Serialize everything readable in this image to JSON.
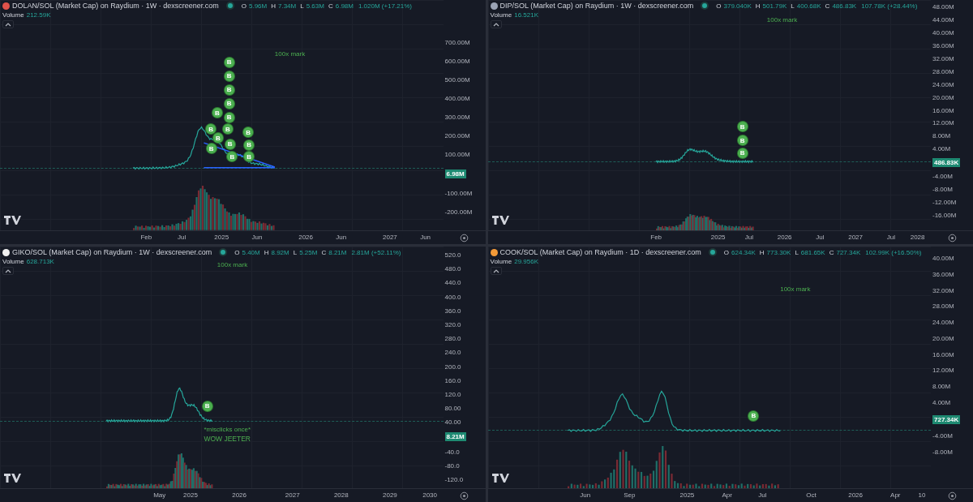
{
  "panels": [
    {
      "title": "DOLAN/SOL (Market Cap) on Raydium · 1W · dexscreener.com",
      "ohlc": [
        {
          "label": "O",
          "value": "5.96M"
        },
        {
          "label": "H",
          "value": "7.34M"
        },
        {
          "label": "L",
          "value": "5.63M"
        },
        {
          "label": "C",
          "value": "6.98M"
        }
      ],
      "change": "1.020M (+17.21%)",
      "volume_label": "Volume",
      "volume": "212.59K",
      "annotations": [
        "100x mark"
      ],
      "markers": [
        "B",
        "B",
        "B",
        "B",
        "B",
        "B",
        "B",
        "B",
        "B",
        "B",
        "B",
        "B",
        "B",
        "B",
        "B"
      ],
      "y_axis": [
        {
          "label": "700.00M",
          "kind": "tick"
        },
        {
          "label": "600.00M",
          "kind": "tick"
        },
        {
          "label": "500.00M",
          "kind": "tick"
        },
        {
          "label": "400.00M",
          "kind": "tick"
        },
        {
          "label": "300.00M",
          "kind": "tick"
        },
        {
          "label": "200.00M",
          "kind": "tick"
        },
        {
          "label": "100.00M",
          "kind": "tick"
        },
        {
          "label": "6.98M",
          "kind": "price"
        },
        {
          "label": "-100.00M",
          "kind": "tick"
        },
        {
          "label": "-200.00M",
          "kind": "tick"
        }
      ],
      "x_axis": [
        "Feb",
        "Jul",
        "2025",
        "Jun",
        "2026",
        "Jun",
        "2027",
        "Jun"
      ]
    },
    {
      "title": "DIP/SOL (Market Cap) on Raydium · 1W · dexscreener.com",
      "ohlc": [
        {
          "label": "O",
          "value": "379.040K"
        },
        {
          "label": "H",
          "value": "501.79K"
        },
        {
          "label": "L",
          "value": "400.68K"
        },
        {
          "label": "C",
          "value": "486.83K"
        }
      ],
      "change": "107.78K (+28.44%)",
      "volume_label": "Volume",
      "volume": "16.521K",
      "annotations": [
        "100x mark"
      ],
      "markers": [
        "B",
        "B",
        "B"
      ],
      "y_axis": [
        {
          "label": "48.00M",
          "kind": "tick"
        },
        {
          "label": "44.00M",
          "kind": "tick"
        },
        {
          "label": "40.00M",
          "kind": "tick"
        },
        {
          "label": "36.00M",
          "kind": "tick"
        },
        {
          "label": "32.00M",
          "kind": "tick"
        },
        {
          "label": "28.00M",
          "kind": "tick"
        },
        {
          "label": "24.00M",
          "kind": "tick"
        },
        {
          "label": "20.00M",
          "kind": "tick"
        },
        {
          "label": "16.00M",
          "kind": "tick"
        },
        {
          "label": "12.00M",
          "kind": "tick"
        },
        {
          "label": "8.00M",
          "kind": "tick"
        },
        {
          "label": "4.00M",
          "kind": "tick"
        },
        {
          "label": "486.83K",
          "kind": "price"
        },
        {
          "label": "-4.00M",
          "kind": "tick"
        },
        {
          "label": "-8.00M",
          "kind": "tick"
        },
        {
          "label": "-12.00M",
          "kind": "tick"
        },
        {
          "label": "-16.00M",
          "kind": "tick"
        }
      ],
      "x_axis": [
        "Feb",
        "2025",
        "Jul",
        "2026",
        "Jul",
        "2027",
        "Jul",
        "2028"
      ]
    },
    {
      "title": "GIKO/SOL (Market Cap) on Raydium · 1W · dexscreener.com",
      "ohlc": [
        {
          "label": "O",
          "value": "5.40M"
        },
        {
          "label": "H",
          "value": "8.92M"
        },
        {
          "label": "L",
          "value": "5.25M"
        },
        {
          "label": "C",
          "value": "8.21M"
        }
      ],
      "change": "2.81M (+52.11%)",
      "volume_label": "Volume",
      "volume": "628.713K",
      "annotations": [
        "100x mark",
        "*misclicks once*",
        "WOW JEETER"
      ],
      "markers": [
        "B"
      ],
      "y_axis": [
        {
          "label": "520.0",
          "kind": "tick"
        },
        {
          "label": "480.0",
          "kind": "tick"
        },
        {
          "label": "440.0",
          "kind": "tick"
        },
        {
          "label": "400.0",
          "kind": "tick"
        },
        {
          "label": "360.0",
          "kind": "tick"
        },
        {
          "label": "320.0",
          "kind": "tick"
        },
        {
          "label": "280.0",
          "kind": "tick"
        },
        {
          "label": "240.0",
          "kind": "tick"
        },
        {
          "label": "200.0",
          "kind": "tick"
        },
        {
          "label": "160.0",
          "kind": "tick"
        },
        {
          "label": "120.0",
          "kind": "tick"
        },
        {
          "label": "80.00",
          "kind": "tick"
        },
        {
          "label": "40.00",
          "kind": "tick"
        },
        {
          "label": "8.21M",
          "kind": "price"
        },
        {
          "label": "-40.0",
          "kind": "tick"
        },
        {
          "label": "-80.0",
          "kind": "tick"
        },
        {
          "label": "-120.0",
          "kind": "tick"
        }
      ],
      "x_axis": [
        "May",
        "2025",
        "2026",
        "2027",
        "2028",
        "2029",
        "2030"
      ]
    },
    {
      "title": "COOK/SOL (Market Cap) on Raydium · 1D · dexscreener.com",
      "ohlc": [
        {
          "label": "O",
          "value": "624.34K"
        },
        {
          "label": "H",
          "value": "773.30K"
        },
        {
          "label": "L",
          "value": "681.65K"
        },
        {
          "label": "C",
          "value": "727.34K"
        }
      ],
      "change": "102.99K (+16.50%)",
      "volume_label": "Volume",
      "volume": "29.956K",
      "annotations": [
        "100x mark"
      ],
      "markers": [
        "B"
      ],
      "y_axis": [
        {
          "label": "40.00M",
          "kind": "tick"
        },
        {
          "label": "36.00M",
          "kind": "tick"
        },
        {
          "label": "32.00M",
          "kind": "tick"
        },
        {
          "label": "28.00M",
          "kind": "tick"
        },
        {
          "label": "24.00M",
          "kind": "tick"
        },
        {
          "label": "20.00M",
          "kind": "tick"
        },
        {
          "label": "16.00M",
          "kind": "tick"
        },
        {
          "label": "12.00M",
          "kind": "tick"
        },
        {
          "label": "8.00M",
          "kind": "tick"
        },
        {
          "label": "4.00M",
          "kind": "tick"
        },
        {
          "label": "727.34K",
          "kind": "price"
        },
        {
          "label": "-4.00M",
          "kind": "tick"
        },
        {
          "label": "-8.00M",
          "kind": "tick"
        }
      ],
      "x_axis": [
        "Jun",
        "Sep",
        "2025",
        "Apr",
        "Jul",
        "Oct",
        "2026",
        "Apr",
        "10"
      ]
    }
  ]
}
